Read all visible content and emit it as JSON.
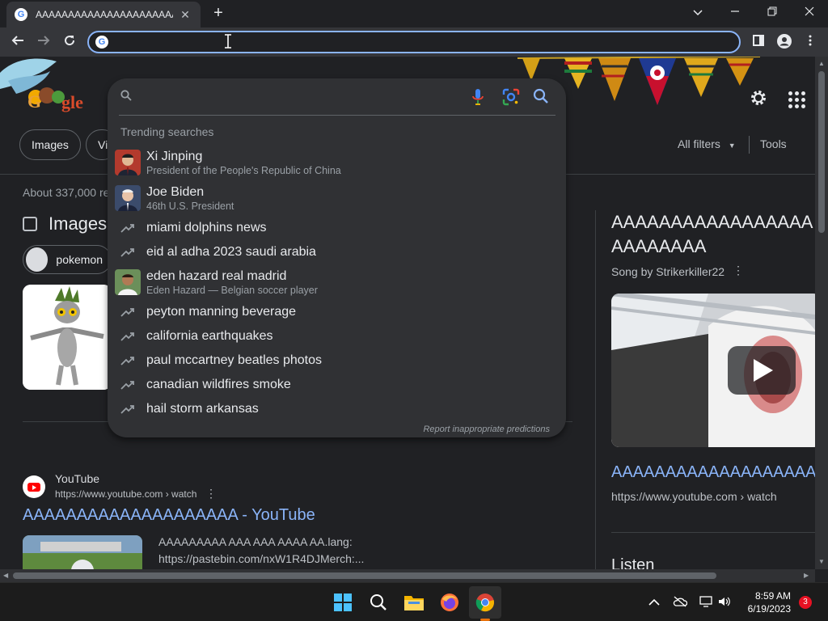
{
  "browser": {
    "tab_title": "AAAAAAAAAAAAAAAAAAAAAAAAAAAAAAA",
    "tab_favicon": "G",
    "close_tab": "✕",
    "new_tab": "+",
    "omnibox_value": "",
    "omnibox_favicon": "G"
  },
  "google": {
    "chips": [
      "Images",
      "Vi"
    ],
    "all_filters": "All filters",
    "tools": "Tools",
    "about": "About 337,000 re",
    "images_heading": "Images",
    "pokemon_chip": "pokemon"
  },
  "dropdown": {
    "input_value": "",
    "heading": "Trending searches",
    "items": [
      {
        "main": "Xi Jinping",
        "sub": "President of the People's Republic of China",
        "type": "person"
      },
      {
        "main": "Joe Biden",
        "sub": "46th U.S. President",
        "type": "person"
      },
      {
        "main": "miami dolphins news",
        "sub": "",
        "type": "trend"
      },
      {
        "main": "eid al adha 2023 saudi arabia",
        "sub": "",
        "type": "trend"
      },
      {
        "main": "eden hazard real madrid",
        "sub": "Eden Hazard — Belgian soccer player",
        "type": "person"
      },
      {
        "main": "peyton manning beverage",
        "sub": "",
        "type": "trend"
      },
      {
        "main": "california earthquakes",
        "sub": "",
        "type": "trend"
      },
      {
        "main": "paul mccartney beatles photos",
        "sub": "",
        "type": "trend"
      },
      {
        "main": "canadian wildfires smoke",
        "sub": "",
        "type": "trend"
      },
      {
        "main": "hail storm arkansas",
        "sub": "",
        "type": "trend"
      }
    ],
    "report": "Report inappropriate predictions"
  },
  "result": {
    "site": "YouTube",
    "url": "https://www.youtube.com › watch",
    "title": "AAAAAAAAAAAAAAAAAAAA - YouTube",
    "snippet_line1": "AAAAAAAAA AAA AAA AAAA AA.lang:",
    "snippet_line2": "https://pastebin.com/nxW1R4DJMerch:..."
  },
  "knowledge_panel": {
    "title_line1": "AAAAAAAAAAAAAAAAA",
    "title_line2": "AAAAAAAA",
    "subtitle": "Song by Strikerkiller22",
    "link": "AAAAAAAAAAAAAAAAAAAAAAA",
    "url": "https://www.youtube.com › watch",
    "listen": "Listen"
  },
  "taskbar": {
    "time": "8:59 AM",
    "date": "6/19/2023",
    "notification_count": "3"
  },
  "colors": {
    "accent_blue": "#8ab4f8",
    "background": "#202124",
    "surface": "#303134"
  }
}
